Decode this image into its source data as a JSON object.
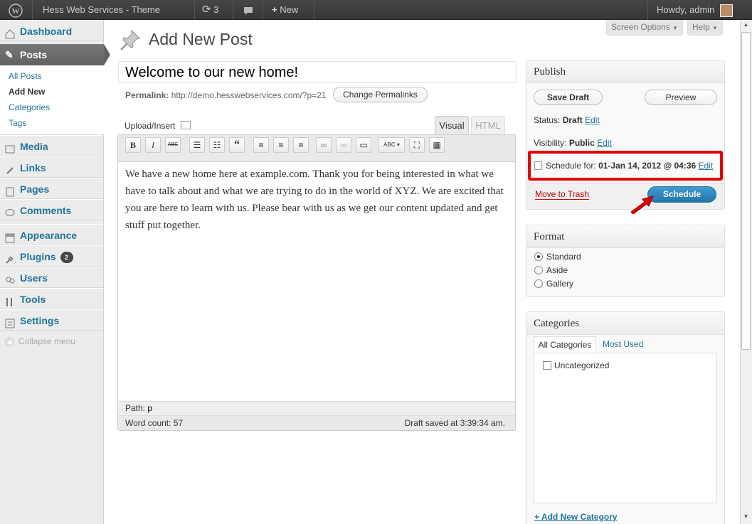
{
  "admin_bar": {
    "site_name": "Hess Web Services - Theme Demo",
    "updates_count": "3",
    "new_label": "New",
    "howdy": "Howdy, admin"
  },
  "menu": {
    "dashboard": "Dashboard",
    "posts": "Posts",
    "posts_sub": [
      "All Posts",
      "Add New",
      "Categories",
      "Tags"
    ],
    "media": "Media",
    "links": "Links",
    "pages": "Pages",
    "comments": "Comments",
    "appearance": "Appearance",
    "plugins": "Plugins",
    "plugins_badge": "2",
    "users": "Users",
    "tools": "Tools",
    "settings": "Settings",
    "collapse": "Collapse menu"
  },
  "screen_options": "Screen Options",
  "help": "Help",
  "page_title": "Add New Post",
  "post": {
    "title": "Welcome to our new home!",
    "permalink_label": "Permalink:",
    "permalink_url": "http://demo.hesswebservices.com/?p=21",
    "change_permalinks": "Change Permalinks"
  },
  "editor": {
    "upload_insert": "Upload/Insert",
    "tab_visual": "Visual",
    "tab_html": "HTML",
    "content": "We have a new home here at example.com. Thank you for being interested in what we have to talk about and what we are trying to do in the world of XYZ. We are excited that you are here to learn with us. Please bear with us as we get our content updated and get stuff put together.",
    "path_label": "Path:",
    "path_value": "p",
    "word_count": "Word count: 57",
    "draft_saved": "Draft saved at 3:39:34 am."
  },
  "publish": {
    "heading": "Publish",
    "save_draft": "Save Draft",
    "preview": "Preview",
    "status_label": "Status:",
    "status_value": "Draft",
    "visibility_label": "Visibility:",
    "visibility_value": "Public",
    "schedule_label": "Schedule for:",
    "schedule_value": "01-Jan 14, 2012 @ 04:36",
    "edit": "Edit",
    "move_to_trash": "Move to Trash",
    "schedule_button": "Schedule"
  },
  "format": {
    "heading": "Format",
    "options": [
      "Standard",
      "Aside",
      "Gallery"
    ],
    "selected": "Standard"
  },
  "categories": {
    "heading": "Categories",
    "tab_all": "All Categories",
    "tab_most_used": "Most Used",
    "items": [
      "Uncategorized"
    ],
    "add_new": "+ Add New Category"
  },
  "colors": {
    "highlight_border": "#e00000",
    "accent": "#21759b",
    "schedule_button": "#2e8ec4"
  }
}
